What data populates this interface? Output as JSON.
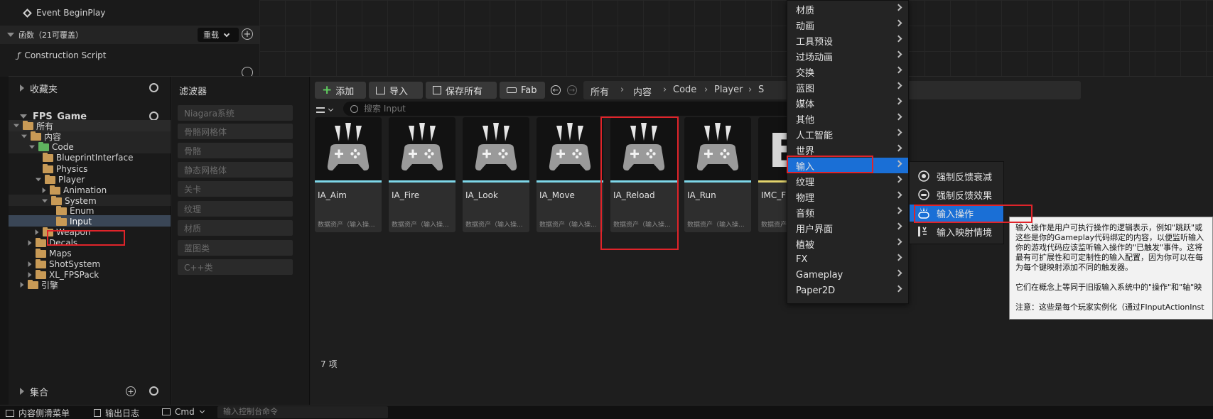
{
  "blueprint_panel": {
    "event_label": "Event BeginPlay",
    "functions_header": "函数（21可覆盖）",
    "override_button": "重载",
    "construction_script": "Construction Script"
  },
  "tree_panel": {
    "favorites_label": "收藏夹",
    "project_label": "FPS_Game",
    "collections_label": "集合",
    "items": [
      {
        "label": "所有"
      },
      {
        "label": "内容"
      },
      {
        "label": "Code"
      },
      {
        "label": "BlueprintInterface"
      },
      {
        "label": "Physics"
      },
      {
        "label": "Player"
      },
      {
        "label": "Animation"
      },
      {
        "label": "System"
      },
      {
        "label": "Enum"
      },
      {
        "label": "Input"
      },
      {
        "label": "Weapon"
      },
      {
        "label": "Decals"
      },
      {
        "label": "Maps"
      },
      {
        "label": "ShotSystem"
      },
      {
        "label": "XL_FPSPack"
      },
      {
        "label": "引擎"
      }
    ]
  },
  "filters_panel": {
    "title": "滤波器",
    "items": [
      "Niagara系统",
      "骨骼网格体",
      "骨骼",
      "静态网格体",
      "关卡",
      "纹理",
      "材质",
      "蓝图类",
      "C++类"
    ]
  },
  "toolbar": {
    "add_label": "添加",
    "import_label": "导入",
    "save_all_label": "保存所有",
    "fab_label": "Fab",
    "breadcrumbs": [
      "所有",
      "内容",
      "Code",
      "Player",
      "S"
    ],
    "search_placeholder": "搜索 Input"
  },
  "assets": [
    {
      "name": "IA_Aim",
      "type": "数据资产（输入操..."
    },
    {
      "name": "IA_Fire",
      "type": "数据资产（输入操..."
    },
    {
      "name": "IA_Look",
      "type": "数据资产（输入操..."
    },
    {
      "name": "IA_Move",
      "type": "数据资产（输入操..."
    },
    {
      "name": "IA_Reload",
      "type": "数据资产（输入操..."
    },
    {
      "name": "IA_Run",
      "type": "数据资产（输入操..."
    },
    {
      "name": "IMC_FP",
      "type": "数据资产（输入映..."
    }
  ],
  "item_count": "7 项",
  "context_menu": {
    "items": [
      "材质",
      "动画",
      "工具预设",
      "过场动画",
      "交换",
      "蓝图",
      "媒体",
      "其他",
      "人工智能",
      "世界",
      "输入",
      "纹理",
      "物理",
      "音频",
      "用户界面",
      "植被",
      "FX",
      "Gameplay",
      "Paper2D"
    ],
    "selected": "输入"
  },
  "submenu": {
    "items": [
      "强制反馈衰减",
      "强制反馈效果",
      "输入操作",
      "输入映射情境"
    ],
    "selected": "输入操作"
  },
  "tooltip": {
    "lines": [
      "输入操作是用户可执行操作的逻辑表示，例如\"跳跃\"或",
      "这些是你的Gameplay代码绑定的内容，以便监听输入",
      "你的游戏代码应该监听输入操作的\"已触发\"事件。这将",
      "最有可扩展性和可定制性的输入配置，因为你可以在每",
      "为每个键映射添加不同的触发器。",
      "",
      "它们在概念上等同于旧版输入系统中的\"操作\"和\"轴\"映",
      "",
      "注意：这些是每个玩家实例化（通过FInputActionInst"
    ]
  },
  "statusbar": {
    "drawer_label": "内容侧滑菜单",
    "output_log_label": "输出日志",
    "cmd_label": "Cmd",
    "console_placeholder": "输入控制台命令"
  },
  "colors": {
    "selection_blue": "#1a6fd6",
    "highlight_red": "#e0242a",
    "input_action_bar": "#7ed7e9",
    "mapping_context_bar": "#e3d46d"
  }
}
